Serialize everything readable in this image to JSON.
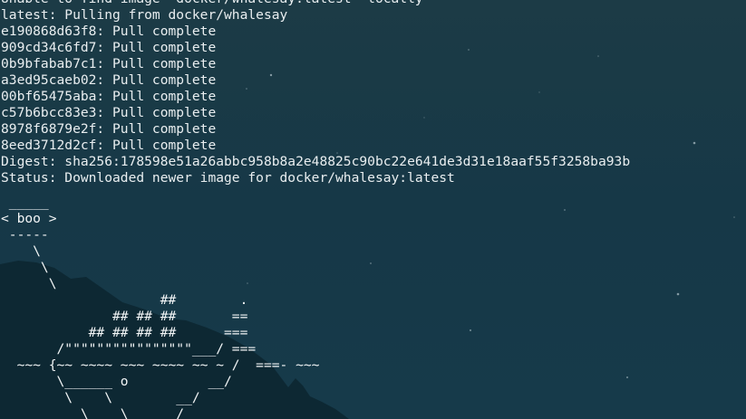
{
  "terminal": {
    "lines": [
      "Unable to find image 'docker/whalesay:latest' locally",
      "latest: Pulling from docker/whalesay",
      "e190868d63f8: Pull complete",
      "909cd34c6fd7: Pull complete",
      "0b9bfabab7c1: Pull complete",
      "a3ed95caeb02: Pull complete",
      "00bf65475aba: Pull complete",
      "c57b6bcc83e3: Pull complete",
      "8978f6879e2f: Pull complete",
      "8eed3712d2cf: Pull complete",
      "Digest: sha256:178598e51a26abbc958b8a2e48825c90bc22e641de3d31e18aaf55f3258ba93b",
      "Status: Downloaded newer image for docker/whalesay:latest"
    ],
    "whalesay_art": " _____\n< boo >\n -----\n    \\\n     \\\n      \\\n                    ##        .\n              ## ## ##       ==\n           ## ## ## ##      ===\n       /\"\"\"\"\"\"\"\"\"\"\"\"\"\"\"\"___/ ===\n  ~~~ {~~ ~~~~ ~~~ ~~~~ ~~ ~ /  ===- ~~~\n       \\______ o          __/\n        \\    \\        __/\n          \\____\\______/"
  },
  "colors": {
    "background_top": "#1b3a45",
    "background_bottom": "#123040",
    "text": "#e9eef0",
    "mountain_silhouette": "#0c2530"
  }
}
